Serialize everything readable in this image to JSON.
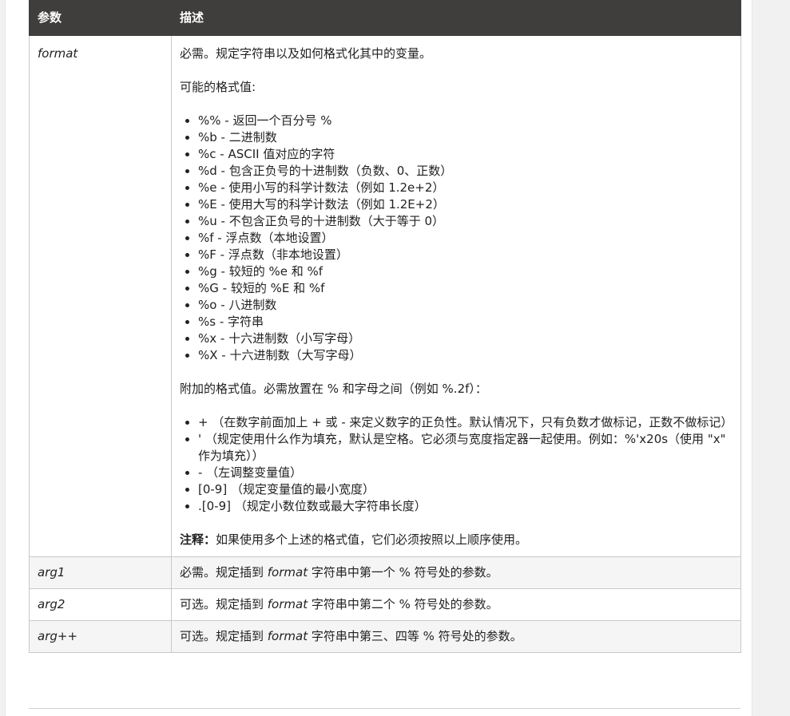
{
  "table": {
    "header": {
      "param": "参数",
      "desc": "描述"
    },
    "format_row": {
      "param": "format",
      "intro": "必需。规定字符串以及如何格式化其中的变量。",
      "possible_label": "可能的格式值:",
      "formats": [
        "%% - 返回一个百分号 %",
        "%b - 二进制数",
        "%c - ASCII 值对应的字符",
        "%d - 包含正负号的十进制数（负数、0、正数）",
        "%e - 使用小写的科学计数法（例如 1.2e+2）",
        "%E - 使用大写的科学计数法（例如 1.2E+2）",
        "%u - 不包含正负号的十进制数（大于等于 0）",
        "%f - 浮点数（本地设置）",
        "%F - 浮点数（非本地设置）",
        "%g - 较短的 %e 和 %f",
        "%G - 较短的 %E 和 %f",
        "%o - 八进制数",
        "%s - 字符串",
        "%x - 十六进制数（小写字母）",
        "%X - 十六进制数（大写字母）"
      ],
      "extra_label": "附加的格式值。必需放置在 % 和字母之间（例如 %.2f）：",
      "extras": [
        "+ （在数字前面加上 + 或 - 来定义数字的正负性。默认情况下，只有负数才做标记，正数不做标记）",
        "' （规定使用什么作为填充，默认是空格。它必须与宽度指定器一起使用。例如：%'x20s（使用 \"x\" 作为填充））",
        "- （左调整变量值）",
        "[0-9] （规定变量值的最小宽度）",
        ".[0-9] （规定小数位数或最大字符串长度）"
      ],
      "note_label": "注释：",
      "note_text": "如果使用多个上述的格式值，它们必须按照以上顺序使用。"
    },
    "arg_rows": [
      {
        "param": "arg1",
        "pre": "必需。规定插到 ",
        "em": "format",
        "post": " 字符串中第一个 % 符号处的参数。"
      },
      {
        "param": "arg2",
        "pre": "可选。规定插到 ",
        "em": "format",
        "post": " 字符串中第二个 % 符号处的参数。"
      },
      {
        "param": "arg++",
        "pre": "可选。规定插到 ",
        "em": "format",
        "post": " 字符串中第三、四等 % 符号处的参数。"
      }
    ]
  },
  "colors": {
    "header_bg": "#3f3e3c",
    "alt_row_bg": "#f5f5f5",
    "border": "#c9c9c9"
  }
}
